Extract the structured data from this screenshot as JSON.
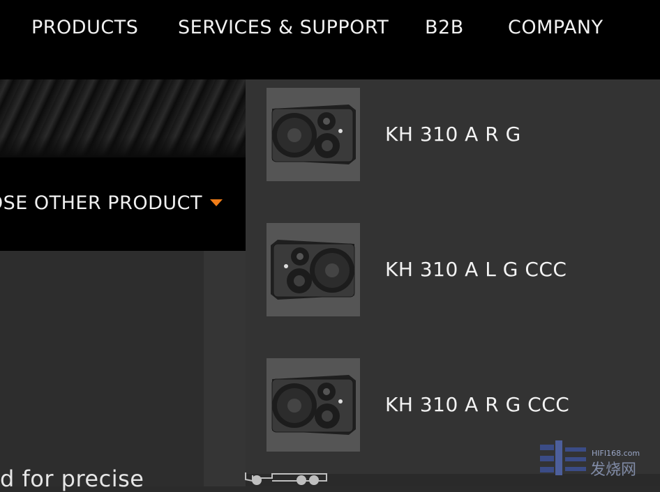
{
  "nav": {
    "items": [
      {
        "label": "PRODUCTS"
      },
      {
        "label": "SERVICES & SUPPORT"
      },
      {
        "label": "B2B"
      },
      {
        "label": "COMPANY"
      }
    ]
  },
  "chooser": {
    "label": "OSE OTHER PRODUCT",
    "caret_color": "#f07d18"
  },
  "product_list": {
    "items": [
      {
        "name": "KH 310 A R G",
        "icon": "speaker-right-icon"
      },
      {
        "name": "KH 310 A L G CCC",
        "icon": "speaker-left-icon"
      },
      {
        "name": "KH 310 A R G CCC",
        "icon": "speaker-right-icon"
      }
    ]
  },
  "content": {
    "body_text": "d for precise"
  },
  "watermark": {
    "url": "HIFI168.com",
    "text": "发烧网"
  }
}
